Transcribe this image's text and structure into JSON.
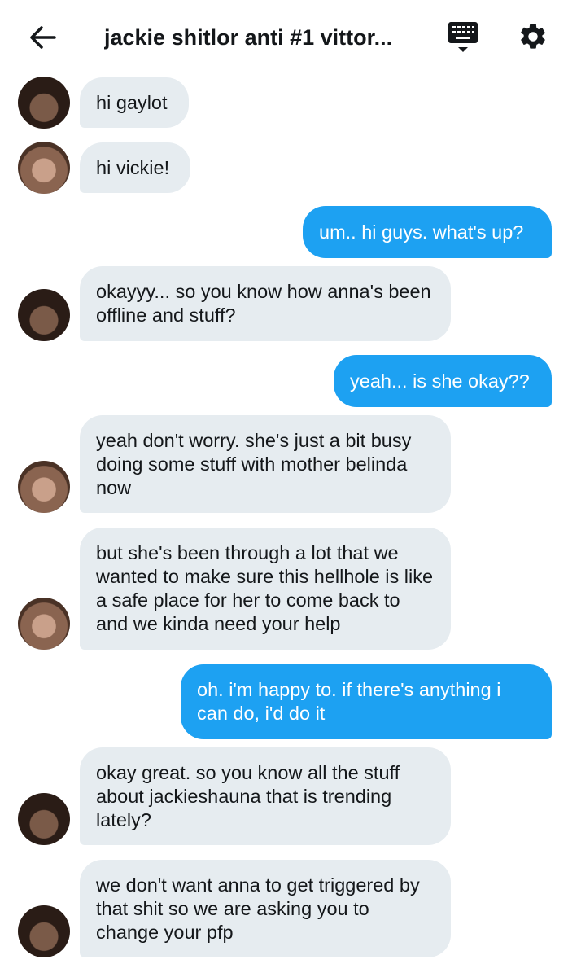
{
  "header": {
    "title": "jackie shitlor anti #1 vittor...",
    "back_icon": "arrow-left-icon",
    "keyboard_icon": "keyboard-icon",
    "settings_icon": "gear-icon"
  },
  "colors": {
    "incoming_bubble": "#e6ecf0",
    "outgoing_bubble": "#1da1f2",
    "text_dark": "#14171a",
    "text_light": "#ffffff"
  },
  "messages": [
    {
      "side": "in",
      "avatar": "vickie",
      "text": "hi gaylot"
    },
    {
      "side": "in",
      "avatar": "gaylot",
      "text": "hi vickie!"
    },
    {
      "side": "out",
      "text": "um.. hi guys. what's up?"
    },
    {
      "side": "in",
      "avatar": "vickie",
      "text": "okayyy... so you know how anna's been offline and stuff?"
    },
    {
      "side": "out",
      "text": "yeah... is she okay??"
    },
    {
      "side": "in",
      "avatar": "gaylot",
      "text": "yeah don't worry. she's just a bit busy doing some stuff with mother belinda now"
    },
    {
      "side": "in",
      "avatar": "gaylot",
      "text": "but she's been through a lot that we wanted to make sure this hellhole is like a safe place for her to come back to and we kinda need your help"
    },
    {
      "side": "out",
      "text": "oh. i'm happy to. if there's anything i can do, i'd do it"
    },
    {
      "side": "in",
      "avatar": "vickie",
      "text": "okay great. so you know all the stuff about jackieshauna that is trending lately?"
    },
    {
      "side": "in",
      "avatar": "vickie",
      "text": "we don't want anna to get triggered by that shit so we are asking you to change your pfp"
    }
  ]
}
